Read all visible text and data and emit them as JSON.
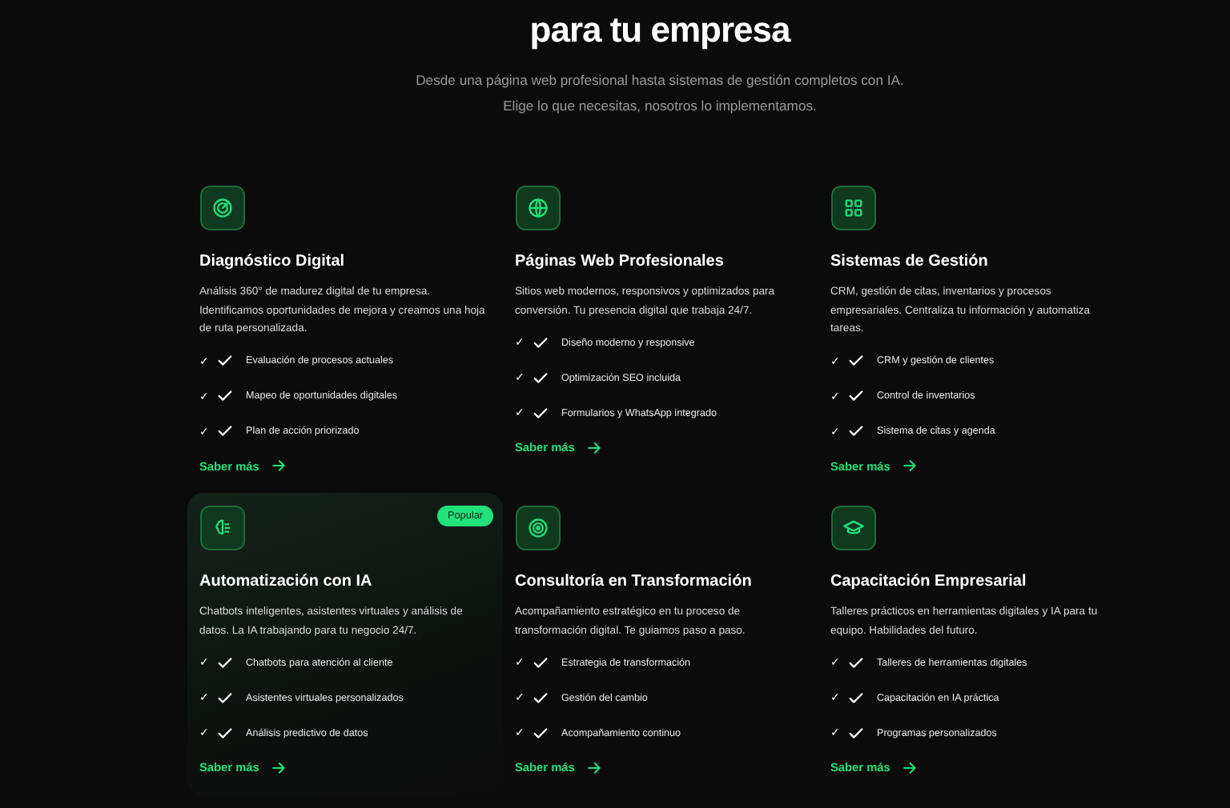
{
  "header": {
    "title": "para tu empresa",
    "subtitle_lines": [
      "Desde una página web profesional hasta sistemas de gestión completos con IA.",
      "Elige lo que necesitas, nosotros lo implementamos."
    ]
  },
  "services": [
    {
      "title": "Diagnóstico Digital",
      "description": "Análisis 360° de madurez digital de tu empresa. Identificamos oportunidades de mejora y creamos una hoja de ruta personalizada.",
      "featured": false,
      "features": [
        {
          "mark": "✓",
          "text": "Evaluación de procesos actuales"
        },
        {
          "mark": "✓",
          "text": "Mapeo de oportunidades digitales"
        },
        {
          "mark": "✓",
          "text": "Plan de acción priorizado"
        }
      ],
      "link": "Saber más"
    },
    {
      "title": "Páginas Web Profesionales",
      "description": "Sitios web modernos, responsivos y optimizados para conversión. Tu presencia digital que trabaja 24/7.",
      "featured": false,
      "features": [
        {
          "mark": "✓",
          "text": "Diseño moderno y responsive"
        },
        {
          "mark": "✓",
          "text": "Optimización SEO incluida"
        },
        {
          "mark": "✓",
          "text": "Formularios y WhatsApp integrado"
        }
      ],
      "link": "Saber más"
    },
    {
      "title": "Sistemas de Gestión",
      "description": "CRM, gestión de citas, inventarios y procesos empresariales. Centraliza tu información y automatiza tareas.",
      "featured": false,
      "features": [
        {
          "mark": "✓",
          "text": "CRM y gestión de clientes"
        },
        {
          "mark": "✓",
          "text": "Control de inventarios"
        },
        {
          "mark": "✓",
          "text": "Sistema de citas y agenda"
        }
      ],
      "link": "Saber más"
    },
    {
      "title": "Automatización con IA",
      "description": "Chatbots inteligentes, asistentes virtuales y análisis de datos. La IA trabajando para tu negocio 24/7.",
      "featured": true,
      "badge": "Popular",
      "features": [
        {
          "mark": "✓",
          "text": "Chatbots para atención al cliente"
        },
        {
          "mark": "✓",
          "text": "Asistentes virtuales personalizados"
        },
        {
          "mark": "✓",
          "text": "Análisis predictivo de datos"
        }
      ],
      "link": "Saber más"
    },
    {
      "title": "Consultoría en Transformación",
      "description": "Acompañamiento estratégico en tu proceso de transformación digital. Te guiamos paso a paso.",
      "featured": false,
      "features": [
        {
          "mark": "✓",
          "text": "Estrategia de transformación"
        },
        {
          "mark": "✓",
          "text": "Gestión del cambio"
        },
        {
          "mark": "✓",
          "text": "Acompañamiento continuo"
        }
      ],
      "link": "Saber más"
    },
    {
      "title": "Capacitación Empresarial",
      "description": "Talleres prácticos en herramientas digitales y IA para tu equipo. Habilidades del futuro.",
      "featured": false,
      "features": [
        {
          "mark": "✓",
          "text": "Talleres de herramientas digitales"
        },
        {
          "mark": "✓",
          "text": "Capacitación en IA práctica"
        },
        {
          "mark": "✓",
          "text": "Programas personalizados"
        }
      ],
      "link": "Saber más"
    }
  ]
}
